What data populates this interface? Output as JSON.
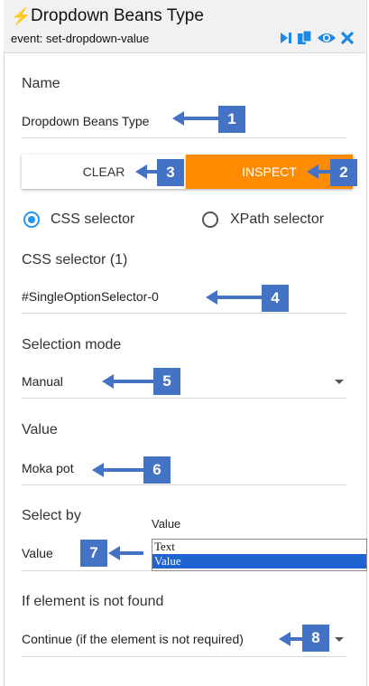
{
  "header": {
    "title": "Dropdown Beans Type",
    "subtitle": "event: set-dropdown-value"
  },
  "name_field": {
    "label": "Name",
    "value": "Dropdown Beans Type"
  },
  "buttons": {
    "clear": "CLEAR",
    "inspect": "INSPECT"
  },
  "selector_type": {
    "css": "CSS selector",
    "xpath": "XPath selector",
    "selected": "css"
  },
  "css_field": {
    "label": "CSS selector (1)",
    "value": "#SingleOptionSelector-0"
  },
  "selection_mode": {
    "label": "Selection mode",
    "value": "Manual"
  },
  "value_field": {
    "label": "Value",
    "value": "Moka pot"
  },
  "select_by": {
    "label": "Select by",
    "value": "Value",
    "listbox_title": "Value",
    "options": [
      "Text",
      "Value"
    ],
    "selected_option": "Value"
  },
  "not_found": {
    "label": "If element is not found",
    "value": "Continue (if the element is not required)"
  },
  "callouts": [
    "1",
    "2",
    "3",
    "4",
    "5",
    "6",
    "7",
    "8"
  ],
  "colors": {
    "accent_orange": "#ff8c00",
    "radio_blue": "#2196f3",
    "callout_blue": "#4472c4",
    "header_icon_blue": "#1e88e5"
  }
}
